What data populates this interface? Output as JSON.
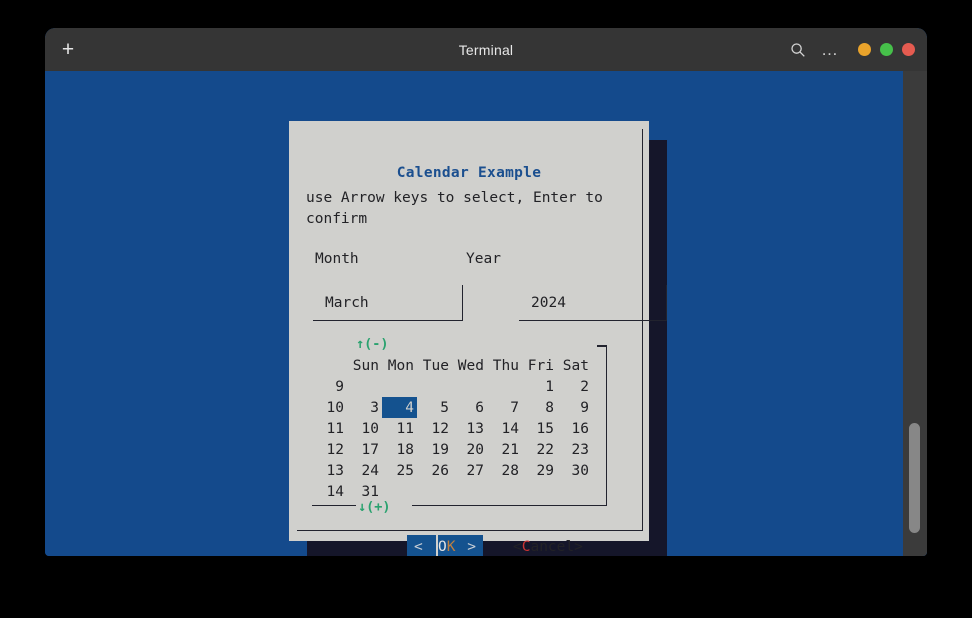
{
  "window": {
    "title": "Terminal",
    "new_tab_icon": "plus-icon",
    "search_icon": "search-icon",
    "menu_icon": "…",
    "controls": [
      {
        "name": "minimize",
        "color": "#e9a32b"
      },
      {
        "name": "maximize",
        "color": "#46c04a"
      },
      {
        "name": "close",
        "color": "#e55b50"
      }
    ],
    "background": "#144a8c",
    "titlebar_background": "#353535"
  },
  "dialog": {
    "title": "Calendar Example",
    "title_color": "#1b4f8f",
    "help_text": "use Arrow keys to select, Enter to confirm",
    "background": "#d0d0cd",
    "shadow_color": "#15162a",
    "fields": {
      "month": {
        "label": "Month",
        "value": "March"
      },
      "year": {
        "label": "Year",
        "value": "2024"
      }
    },
    "calendar": {
      "up_indicator": "↑(-)",
      "down_indicator": "↓(+)",
      "indicator_color": "#2aa26f",
      "weekday_headers": [
        "Sun",
        "Mon",
        "Tue",
        "Wed",
        "Thu",
        "Fri",
        "Sat"
      ],
      "selected_day": 4,
      "selection_color": "#14528f",
      "rows": [
        {
          "week": "9",
          "days": [
            "",
            "",
            "",
            "",
            "",
            "1",
            "2"
          ]
        },
        {
          "week": "10",
          "days": [
            "3",
            "4",
            "5",
            "6",
            "7",
            "8",
            "9"
          ]
        },
        {
          "week": "11",
          "days": [
            "10",
            "11",
            "12",
            "13",
            "14",
            "15",
            "16"
          ]
        },
        {
          "week": "12",
          "days": [
            "17",
            "18",
            "19",
            "20",
            "21",
            "22",
            "23"
          ]
        },
        {
          "week": "13",
          "days": [
            "24",
            "25",
            "26",
            "27",
            "28",
            "29",
            "30"
          ]
        },
        {
          "week": "14",
          "days": [
            "31",
            "",
            "",
            "",
            "",
            "",
            ""
          ]
        }
      ]
    },
    "buttons": {
      "ok": {
        "left_arrow": "<",
        "right_arrow": ">",
        "label_plain": "O",
        "label_hotkey": "K",
        "focused": true
      },
      "cancel": {
        "prefix": "<",
        "hotkey": "C",
        "rest": "ancel",
        "suffix": ">"
      }
    }
  },
  "scrollbar": {
    "track_color": "#3b3b3b",
    "thumb_color": "#878787"
  }
}
